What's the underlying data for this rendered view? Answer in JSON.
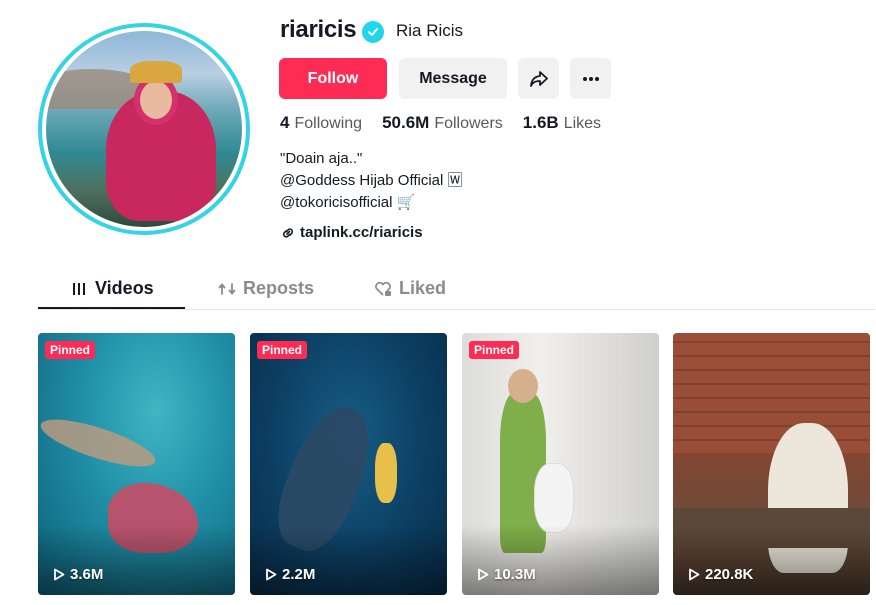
{
  "profile": {
    "username": "riaricis",
    "display_name": "Ria Ricis",
    "verified": true,
    "accent_color": "#fe2c55",
    "ring_color": "#35d3e3"
  },
  "actions": {
    "follow_label": "Follow",
    "message_label": "Message"
  },
  "stats": [
    {
      "value": "4",
      "label": "Following"
    },
    {
      "value": "50.6M",
      "label": "Followers"
    },
    {
      "value": "1.6B",
      "label": "Likes"
    }
  ],
  "bio": {
    "lines": [
      "\"Doain aja..\"",
      "@Goddess Hijab Official 🅆",
      "@tokoricisofficial 🛒"
    ],
    "link": "taplink.cc/riaricis"
  },
  "tabs": [
    {
      "label": "Videos",
      "icon": "grid-icon",
      "active": true
    },
    {
      "label": "Reposts",
      "icon": "repost-icon",
      "active": false
    },
    {
      "label": "Liked",
      "icon": "heart-lock-icon",
      "active": false
    }
  ],
  "videos": [
    {
      "views": "3.6M",
      "pinned": true,
      "pinned_label": "Pinned"
    },
    {
      "views": "2.2M",
      "pinned": true,
      "pinned_label": "Pinned"
    },
    {
      "views": "10.3M",
      "pinned": true,
      "pinned_label": "Pinned"
    },
    {
      "views": "220.8K",
      "pinned": false,
      "pinned_label": ""
    }
  ]
}
